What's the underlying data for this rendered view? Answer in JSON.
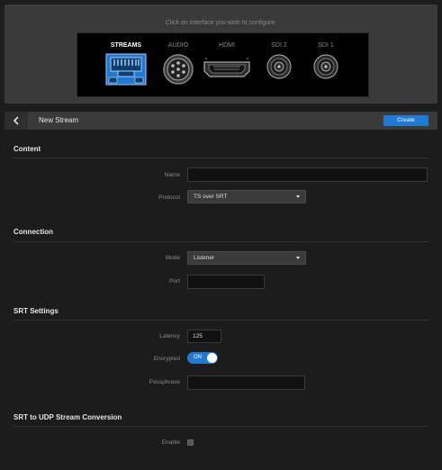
{
  "interface_panel": {
    "hint": "Click on interface you wish to configure.",
    "ports": [
      {
        "label": "STREAMS",
        "icon": "ethernet-port-icon",
        "active": true
      },
      {
        "label": "AUDIO",
        "icon": "audio-connector-icon",
        "active": false
      },
      {
        "label": "HDMI",
        "icon": "hdmi-port-icon",
        "active": false
      },
      {
        "label": "SDI 2",
        "icon": "sdi-connector-icon",
        "active": false
      },
      {
        "label": "SDI 1",
        "icon": "sdi-connector-icon",
        "active": false
      }
    ]
  },
  "header": {
    "title": "New Stream",
    "create_label": "Create",
    "back_icon": "chevron-left-icon"
  },
  "content": {
    "title": "Content",
    "name_label": "Name",
    "name_value": "",
    "protocol_label": "Protocol",
    "protocol_value": "TS over SRT"
  },
  "connection": {
    "title": "Connection",
    "mode_label": "Mode",
    "mode_value": "Listener",
    "port_label": "Port",
    "port_value": ""
  },
  "srt_settings": {
    "title": "SRT Settings",
    "latency_label": "Latency",
    "latency_value": "125",
    "encrypted_label": "Encrypted",
    "encrypted_toggle": "ON",
    "passphrase_label": "Passphrase",
    "passphrase_value": ""
  },
  "srt_to_udp": {
    "title": "SRT to UDP Stream Conversion",
    "enable_label": "Enable",
    "enable_checked": false
  },
  "colors": {
    "accent": "#1f7ad6",
    "background": "#1c1c1c",
    "panel": "#3a3a3a"
  }
}
